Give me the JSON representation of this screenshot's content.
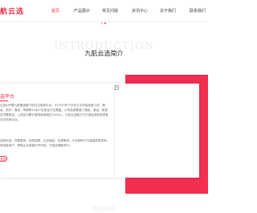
{
  "header": {
    "logo_text": "航云选",
    "nav": [
      {
        "label": "首页",
        "active": true
      },
      {
        "label": "产品展示",
        "active": false
      },
      {
        "label": "常见问题",
        "active": false
      },
      {
        "label": "资讯中心",
        "active": false
      },
      {
        "label": "关于我们",
        "active": false
      },
      {
        "label": "联系我们",
        "active": false
      }
    ]
  },
  "carousel": {
    "dot_count": 2,
    "active_index": 1
  },
  "intro": {
    "watermark": "INTRODUCTION",
    "title": "九航云选简介"
  },
  "card": {
    "title": "选平台",
    "paragraph_1": "云选APP是九航集团旗下的社交电商平台，于2020年下半年正式开始免费入驻，美妆、洗护、食品、母婴等10余个品类全方位覆盖，公司品类覆盖了美妆、食品、家居百货等类目，上线至今累计服务商家超过1000人，九航云选致力于打造品质的新零售社交电商平台。",
    "paragraph_2": "品质优选，货源直采，品质保障，正品保证，优质服务；平台拥有千万级高质量的私域流量用户，帮助企业快速打开市场，打造品牌影响力。",
    "more_label": "更多"
  },
  "colors": {
    "accent": "#e8304a",
    "red_block": "#f22f50"
  },
  "footer": {
    "faint_text": "常见问题"
  }
}
